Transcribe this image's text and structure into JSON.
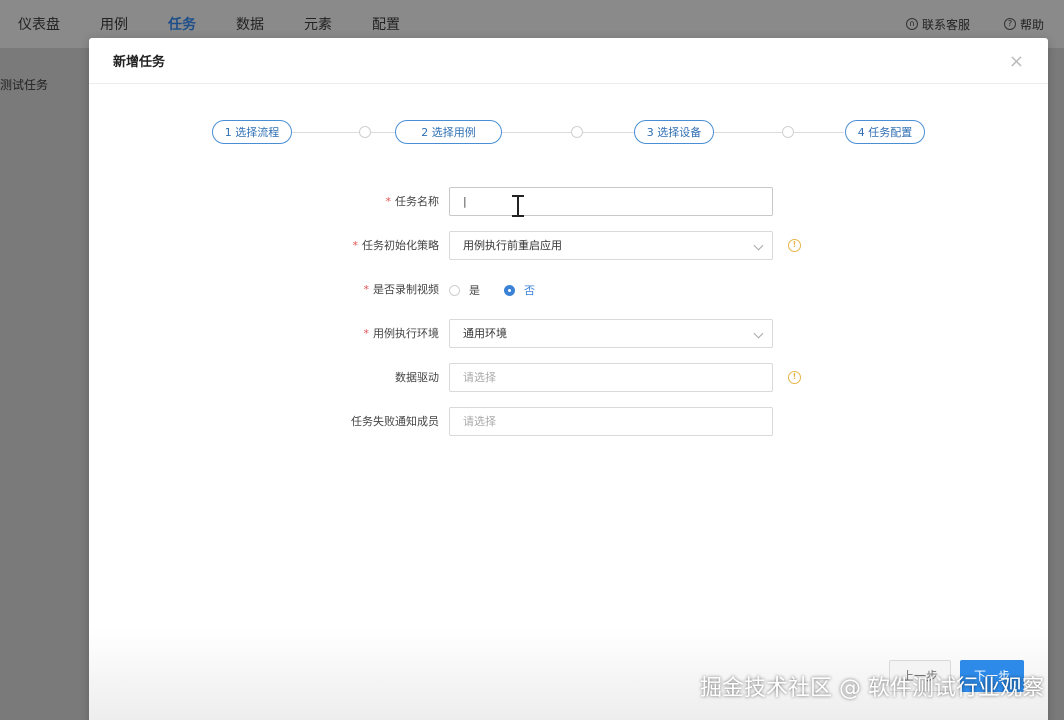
{
  "topnav": {
    "items": [
      "仪表盘",
      "用例",
      "任务",
      "数据",
      "元素",
      "配置"
    ],
    "active_index": 2,
    "support_label": "联系客服",
    "help_label": "帮助"
  },
  "sidebar": {
    "text": "测试任务"
  },
  "modal": {
    "title": "新增任务",
    "close_glyph": "×",
    "steps": [
      "1 选择流程",
      "2 选择用例",
      "3 选择设备",
      "4 任务配置"
    ],
    "form": {
      "task_name": {
        "label": "任务名称",
        "value": "|"
      },
      "init_strategy": {
        "label": "任务初始化策略",
        "value": "用例执行前重启应用"
      },
      "record_video": {
        "label": "是否录制视频",
        "options": [
          "是",
          "否"
        ],
        "selected": "否"
      },
      "exec_env": {
        "label": "用例执行环境",
        "value": "通用环境"
      },
      "data_driven": {
        "label": "数据驱动",
        "placeholder": "请选择"
      },
      "notify_members": {
        "label": "任务失败通知成员",
        "placeholder": "请选择"
      }
    },
    "footer": {
      "prev_label": "上一步",
      "next_label": "下一步"
    }
  },
  "watermark": "掘金技术社区 @ 软件测试行业观察",
  "colors": {
    "accent": "#3b82d6",
    "required": "#e05252",
    "info": "#e6b54a"
  }
}
